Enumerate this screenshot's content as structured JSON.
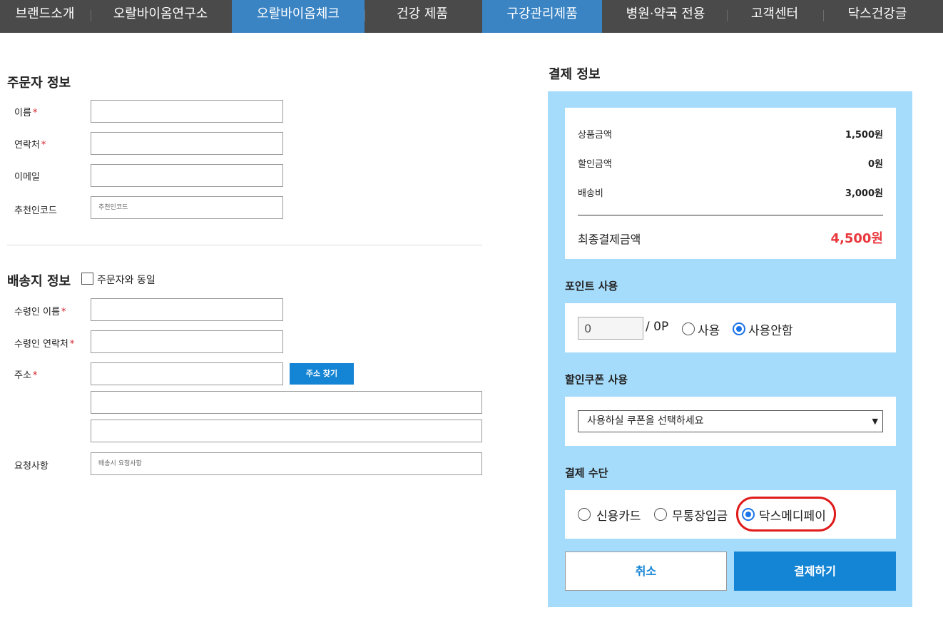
{
  "nav": {
    "items": [
      {
        "label": "브랜드소개"
      },
      {
        "label": "오랄바이옴연구소"
      },
      {
        "label": "오랄바이옴체크"
      },
      {
        "label": "건강 제품"
      },
      {
        "label": "구강관리제품"
      },
      {
        "label": "병원·약국 전용"
      },
      {
        "label": "고객센터"
      },
      {
        "label": "닥스건강글"
      }
    ],
    "active_index": 2
  },
  "orderer": {
    "title": "주문자 정보",
    "name_label": "이름",
    "phone_label": "연락처",
    "email_label": "이메일",
    "referral_label": "추천인코드",
    "referral_placeholder": "추천인코드",
    "required_mark": "*"
  },
  "shipping": {
    "title": "배송지 정보",
    "same_as_orderer_label": "주문자와 동일",
    "recipient_name_label": "수령인 이름",
    "recipient_phone_label": "수령인 연락처",
    "address_label": "주소",
    "address_search_button": "주소 찾기",
    "request_label": "요청사항",
    "request_placeholder": "배송시 요청사항"
  },
  "payment": {
    "title": "결제 정보",
    "summary": {
      "product_amount_label": "상품금액",
      "product_amount_value": "1,500원",
      "discount_label": "할인금액",
      "discount_value": "0원",
      "shipping_label": "배송비",
      "shipping_value": "3,000원",
      "final_label": "최종결제금액",
      "final_value": "4,500원"
    },
    "points": {
      "title": "포인트 사용",
      "value": "0",
      "max": "/ 0P",
      "use_label": "사용",
      "no_use_label": "사용안함",
      "selected": "no_use"
    },
    "coupon": {
      "title": "할인쿠폰 사용",
      "selected": "사용하실 쿠폰을 선택하세요"
    },
    "method": {
      "title": "결제 수단",
      "options": [
        "신용카드",
        "무통장입금",
        "닥스메디페이"
      ],
      "selected_index": 2
    },
    "cancel_button": "취소",
    "pay_button": "결제하기"
  },
  "colors": {
    "nav_bg": "#4a4a4a",
    "nav_active": "#3a84c4",
    "panel_bg": "#a6dcfb",
    "accent_blue": "#1484d4",
    "final_price_red": "#e8383d",
    "highlight_red": "#e01b1b"
  }
}
